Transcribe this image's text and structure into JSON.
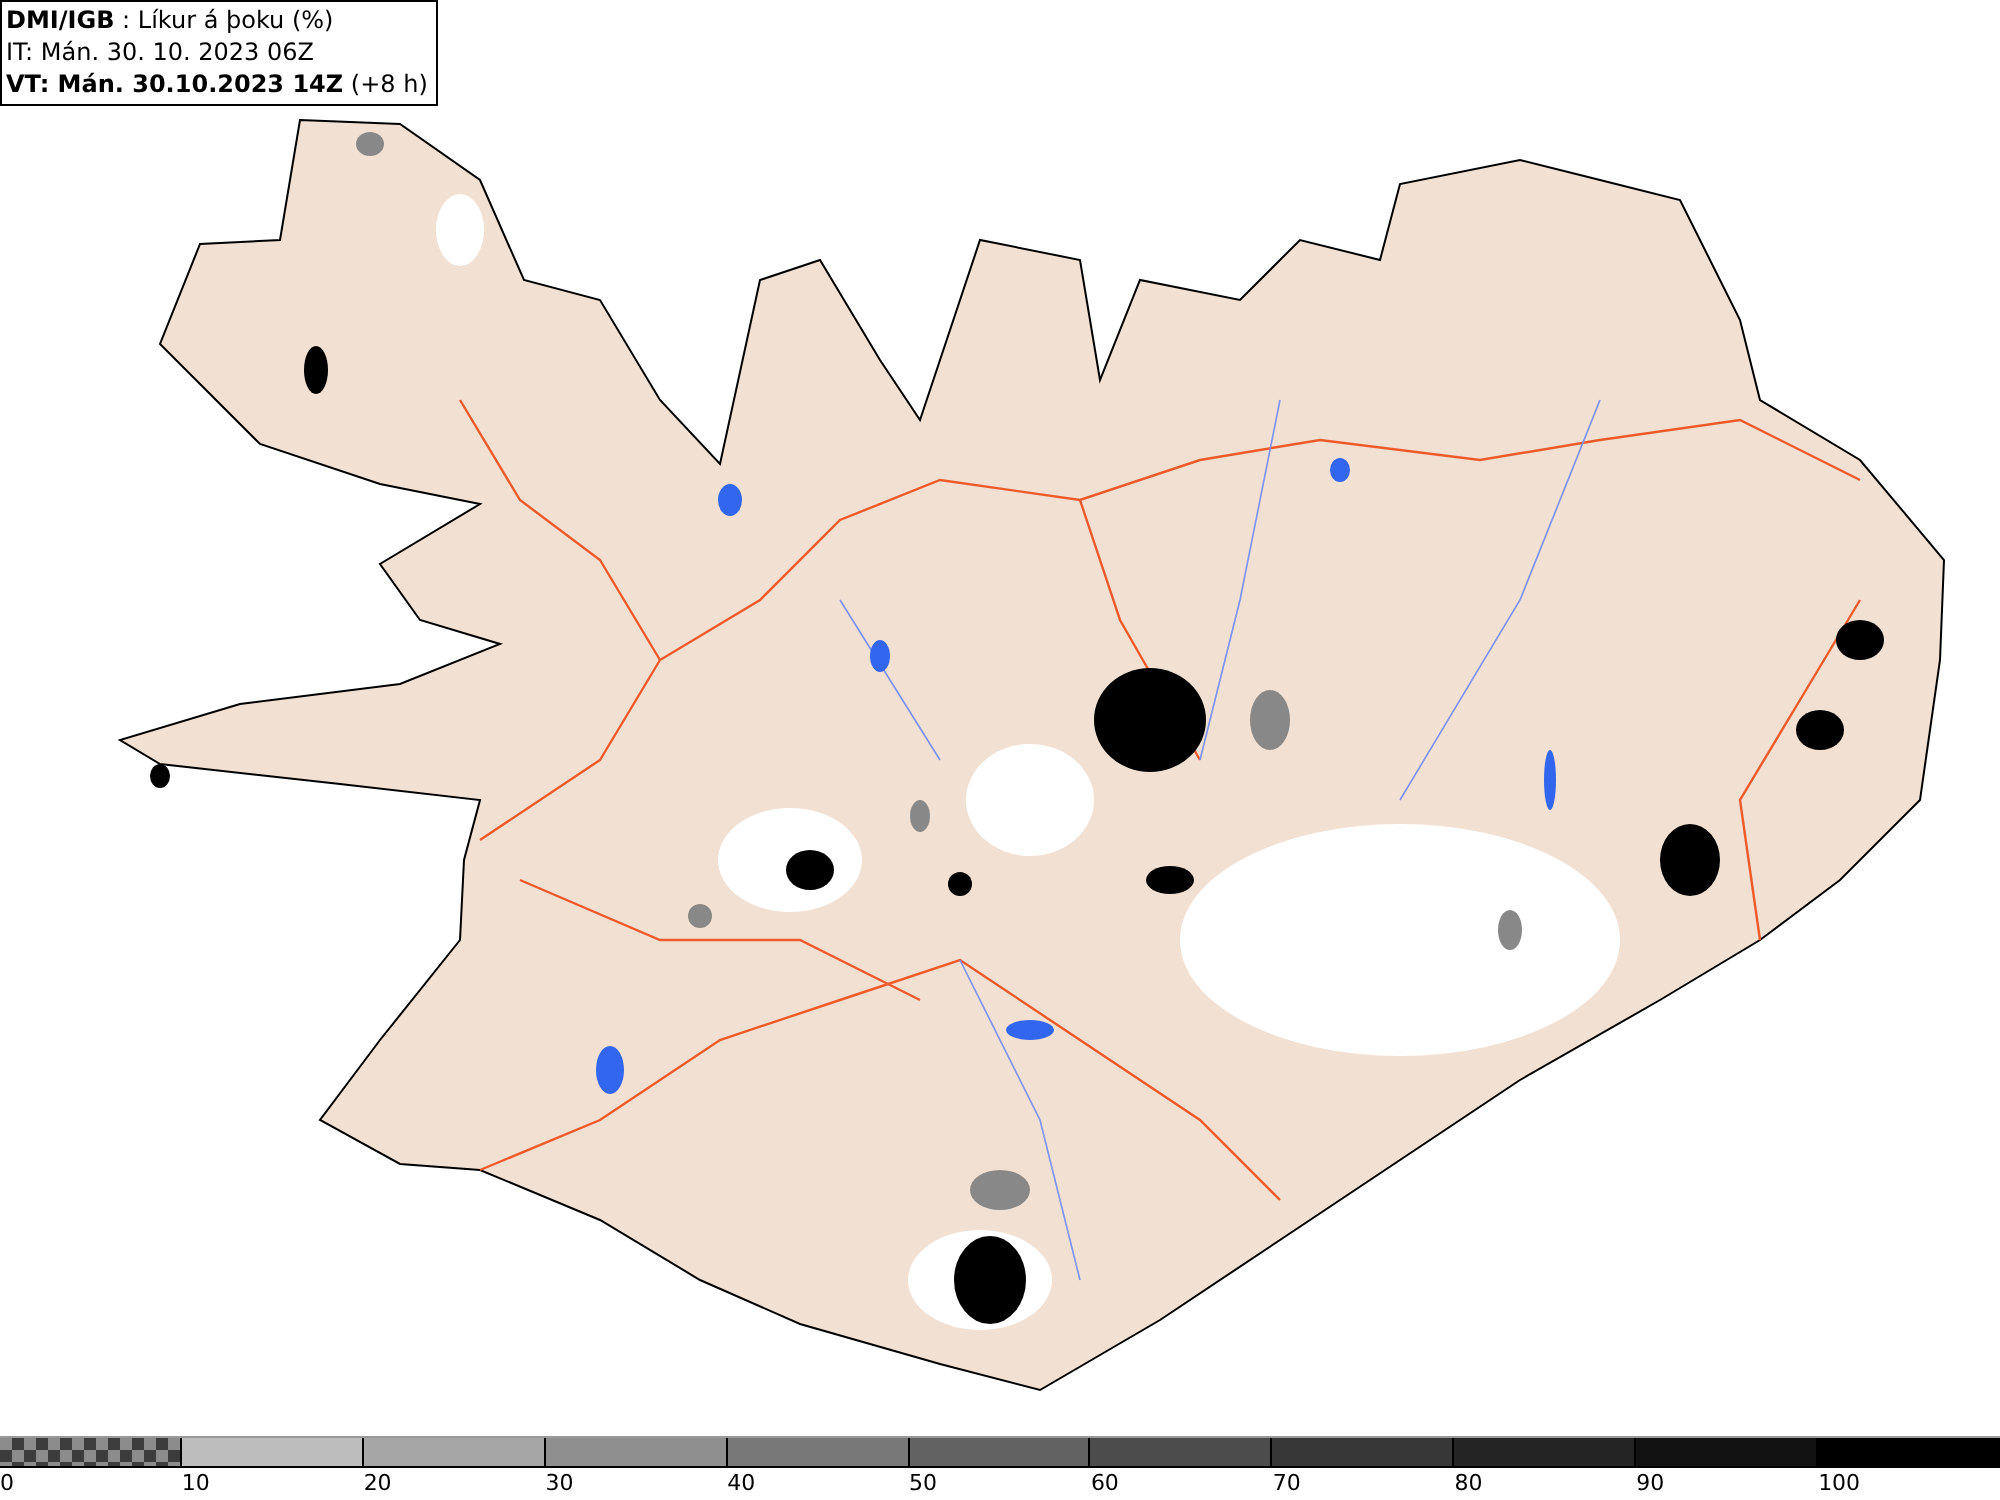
{
  "title_box": {
    "lines": [
      "**DMI/IGB** : Líkur á þoku (%)",
      "IT: Mán. 30. 10. 2023 06Z",
      "**VT: Mán. 30.10.2023 14Z** (+8 h)"
    ]
  },
  "legend": [
    {
      "label": "0",
      "color": "#8c8c8c",
      "kind": "checker"
    },
    {
      "label": "10",
      "color": "#bdbdbd",
      "kind": "solid"
    },
    {
      "label": "20",
      "color": "#a6a6a6",
      "kind": "solid"
    },
    {
      "label": "30",
      "color": "#8f8f8f",
      "kind": "solid"
    },
    {
      "label": "40",
      "color": "#787878",
      "kind": "solid"
    },
    {
      "label": "50",
      "color": "#626262",
      "kind": "solid"
    },
    {
      "label": "60",
      "color": "#4c4c4c",
      "kind": "solid"
    },
    {
      "label": "70",
      "color": "#373737",
      "kind": "solid"
    },
    {
      "label": "80",
      "color": "#242424",
      "kind": "solid"
    },
    {
      "label": "90",
      "color": "#121212",
      "kind": "solid"
    },
    {
      "label": "100",
      "color": "#000000",
      "kind": "solid"
    }
  ]
}
